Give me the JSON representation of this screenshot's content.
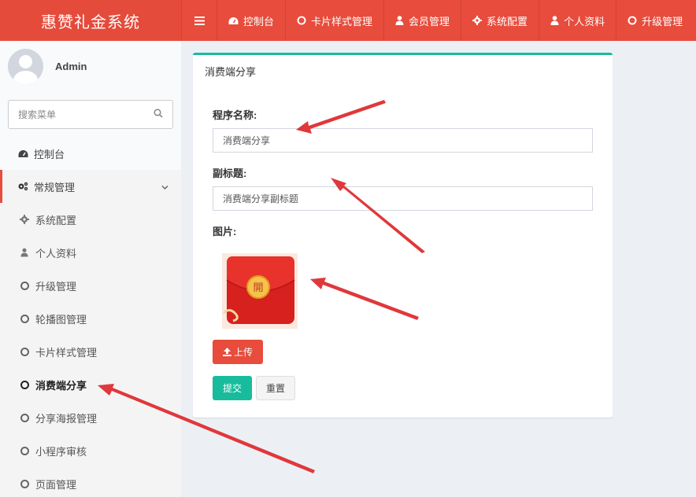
{
  "app": {
    "title": "惠赞礼金系统"
  },
  "topnav": {
    "items": [
      {
        "label": "控制台",
        "icon": "dashboard-icon"
      },
      {
        "label": "卡片样式管理",
        "icon": "circle-icon"
      },
      {
        "label": "会员管理",
        "icon": "user-icon"
      },
      {
        "label": "系统配置",
        "icon": "gear-icon"
      },
      {
        "label": "个人资料",
        "icon": "user-icon"
      },
      {
        "label": "升级管理",
        "icon": "circle-icon"
      }
    ]
  },
  "user": {
    "name": "Admin"
  },
  "search": {
    "placeholder": "搜索菜单"
  },
  "sidebar": {
    "items": [
      {
        "label": "控制台"
      },
      {
        "label": "常规管理"
      },
      {
        "label": "系统配置"
      },
      {
        "label": "个人资料"
      },
      {
        "label": "升级管理"
      },
      {
        "label": "轮播图管理"
      },
      {
        "label": "卡片样式管理"
      },
      {
        "label": "消费端分享"
      },
      {
        "label": "分享海报管理"
      },
      {
        "label": "小程序审核"
      },
      {
        "label": "页面管理"
      }
    ]
  },
  "main": {
    "title": "消费端分享",
    "form": {
      "name_label": "程序名称:",
      "name_value": "消费端分享",
      "subtitle_label": "副标题:",
      "subtitle_value": "消费端分享副标题",
      "image_label": "图片:",
      "image_char": "開",
      "upload_label": "上传",
      "submit_label": "提交",
      "reset_label": "重置"
    }
  },
  "colors": {
    "accent": "#e74c3c",
    "success": "#18bc9c",
    "annotation": "#e0383b"
  }
}
